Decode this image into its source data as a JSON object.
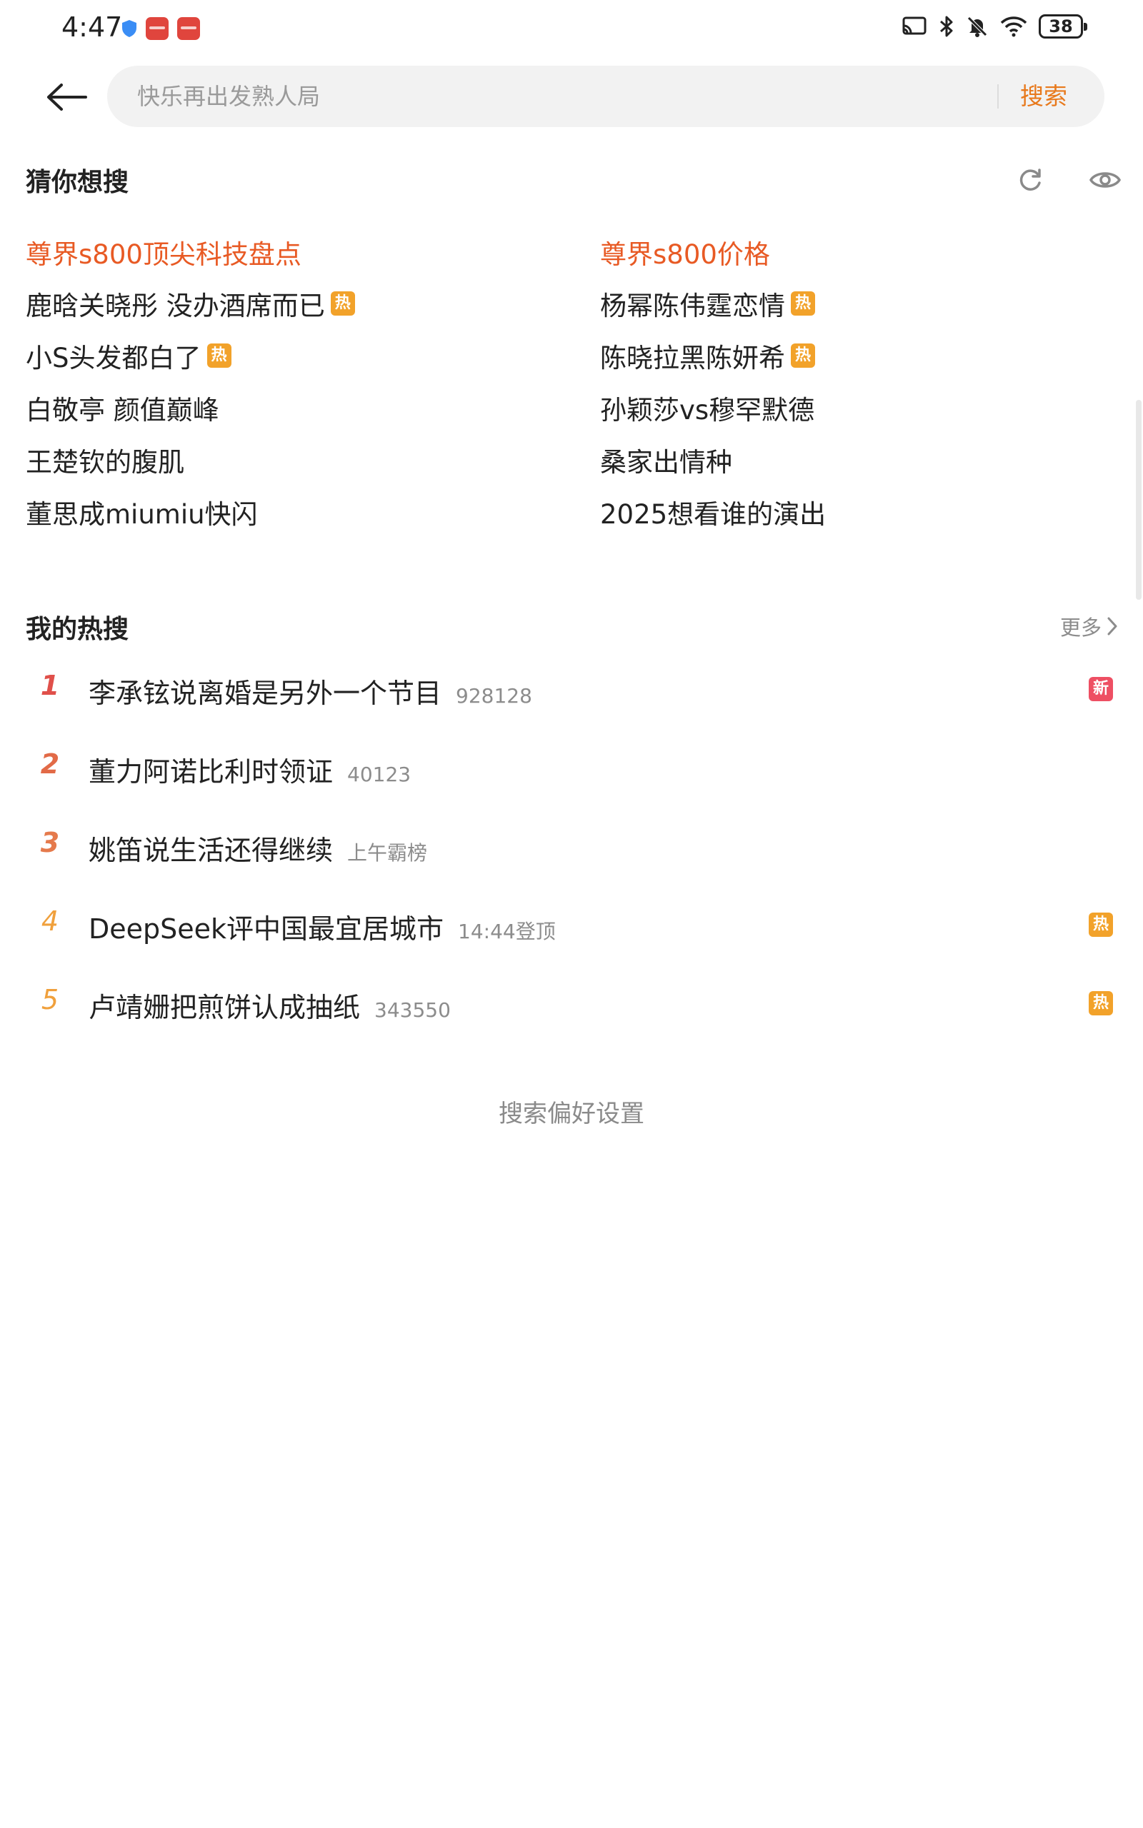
{
  "status": {
    "time": "4:47",
    "battery": "38"
  },
  "search": {
    "placeholder": "快乐再出发熟人局",
    "button": "搜索"
  },
  "guess": {
    "title": "猜你想搜",
    "items": [
      {
        "text": "尊界s800顶尖科技盘点",
        "highlight": true,
        "tag": ""
      },
      {
        "text": "尊界s800价格",
        "highlight": true,
        "tag": ""
      },
      {
        "text": "鹿晗关晓彤 没办酒席而已",
        "highlight": false,
        "tag": "热"
      },
      {
        "text": "杨幂陈伟霆恋情",
        "highlight": false,
        "tag": "热"
      },
      {
        "text": "小S头发都白了",
        "highlight": false,
        "tag": "热"
      },
      {
        "text": "陈晓拉黑陈妍希",
        "highlight": false,
        "tag": "热"
      },
      {
        "text": "白敬亭 颜值巅峰",
        "highlight": false,
        "tag": ""
      },
      {
        "text": "孙颖莎vs穆罕默德",
        "highlight": false,
        "tag": ""
      },
      {
        "text": "王楚钦的腹肌",
        "highlight": false,
        "tag": ""
      },
      {
        "text": "桑家出情种",
        "highlight": false,
        "tag": ""
      },
      {
        "text": "董思成miumiu快闪",
        "highlight": false,
        "tag": ""
      },
      {
        "text": "2025想看谁的演出",
        "highlight": false,
        "tag": ""
      }
    ]
  },
  "hot": {
    "title": "我的热搜",
    "more": "更多",
    "items": [
      {
        "rank": "1",
        "title": "李承铉说离婚是另外一个节目",
        "meta": "928128",
        "tag": "新"
      },
      {
        "rank": "2",
        "title": "董力阿诺比利时领证",
        "meta": "40123",
        "tag": ""
      },
      {
        "rank": "3",
        "title": "姚笛说生活还得继续",
        "meta": "上午霸榜",
        "tag": ""
      },
      {
        "rank": "4",
        "title": "DeepSeek评中国最宜居城市",
        "meta": "14:44登顶",
        "tag": "热"
      },
      {
        "rank": "5",
        "title": "卢靖姗把煎饼认成抽纸",
        "meta": "343550",
        "tag": "热"
      }
    ]
  },
  "footer": {
    "preferences": "搜索偏好设置"
  },
  "colors": {
    "accent": "#e8791c",
    "highlight": "#e85a24",
    "rank1": "#e0504a",
    "rank2": "#e26a47",
    "rank3": "#e57a4c",
    "rank4": "#f0a03c",
    "rank5": "#f0a03c",
    "hot_tag": "#f2a22a",
    "new_tag": "#ee4f63"
  }
}
